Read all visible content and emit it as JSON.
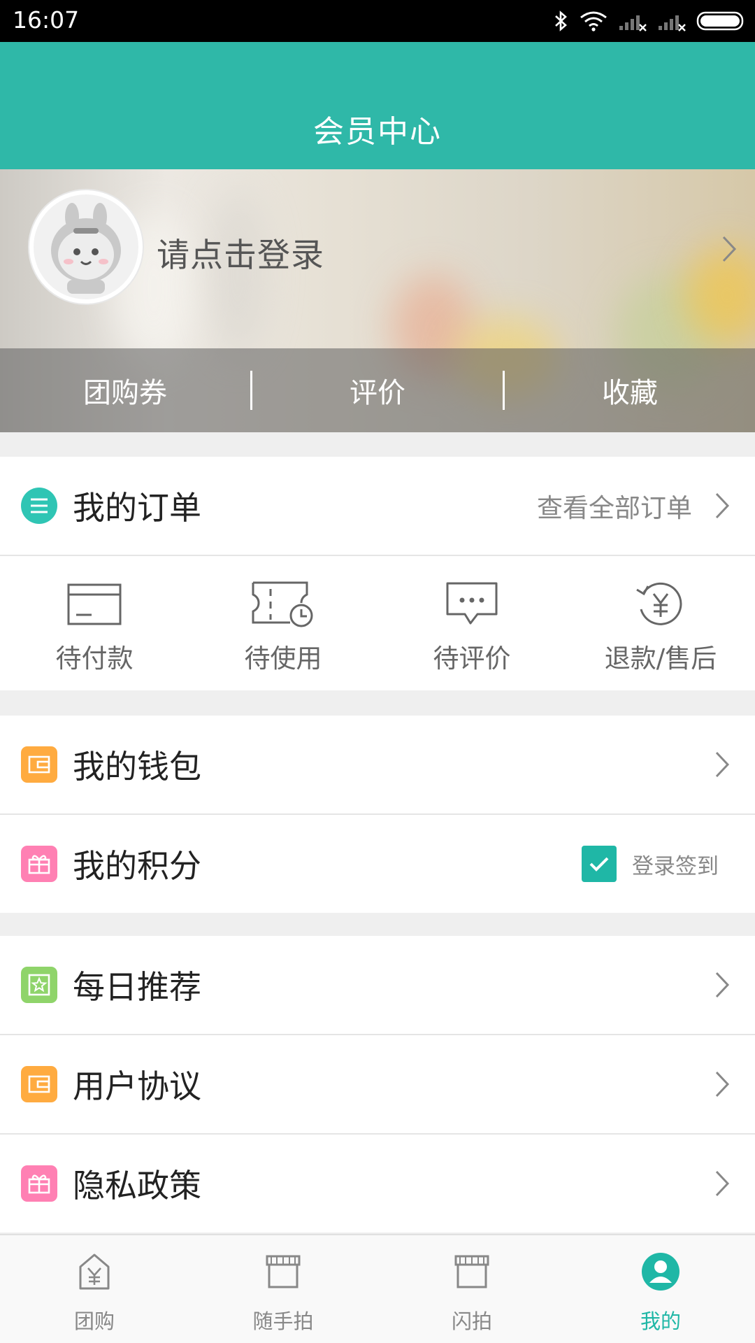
{
  "status_bar": {
    "time": "16:07"
  },
  "header": {
    "title": "会员中心"
  },
  "profile": {
    "login_prompt": "请点击登录",
    "stats": [
      "团购券",
      "评价",
      "收藏"
    ]
  },
  "orders": {
    "title": "我的订单",
    "view_all": "查看全部订单",
    "items": [
      {
        "label": "待付款",
        "icon": "card-icon"
      },
      {
        "label": "待使用",
        "icon": "ticket-clock-icon"
      },
      {
        "label": "待评价",
        "icon": "chat-bubble-icon"
      },
      {
        "label": "退款/售后",
        "icon": "refund-yen-icon"
      }
    ]
  },
  "menu": {
    "wallet": "我的钱包",
    "points": "我的积分",
    "checkin_label": "登录签到",
    "daily": "每日推荐",
    "agreement": "用户协议",
    "privacy": "隐私政策"
  },
  "colors": {
    "accent": "#2fb8a8",
    "orange": "#ffab40",
    "pink": "#ff80b3",
    "green": "#8fd46a"
  },
  "tabbar": {
    "tabs": [
      {
        "label": "团购",
        "icon": "group-buy-icon"
      },
      {
        "label": "随手拍",
        "icon": "shop-icon"
      },
      {
        "label": "闪拍",
        "icon": "shop-icon"
      },
      {
        "label": "我的",
        "icon": "user-icon",
        "active": true
      }
    ]
  }
}
